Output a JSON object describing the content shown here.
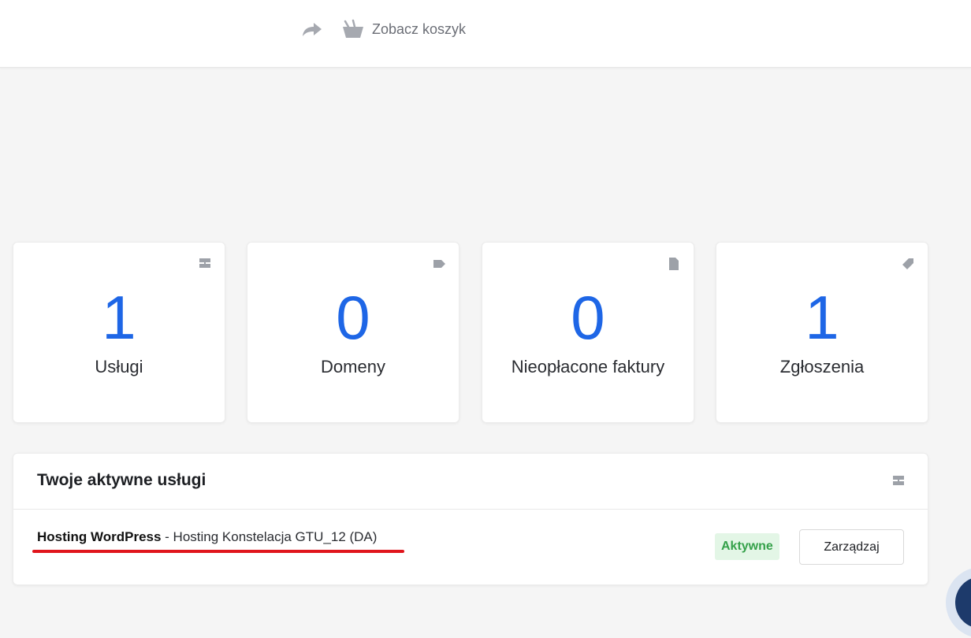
{
  "header": {
    "cart_label": "Zobacz koszyk",
    "icons": {
      "share": "share-arrow-icon",
      "cart": "basket-icon"
    }
  },
  "tiles": [
    {
      "count": "1",
      "title": "Usługi",
      "icon": "server-icon"
    },
    {
      "count": "0",
      "title": "Domeny",
      "icon": "tag-icon"
    },
    {
      "count": "0",
      "title": "Nieopłacone faktury",
      "icon": "document-icon"
    },
    {
      "count": "1",
      "title": "Zgłoszenia",
      "icon": "ticket-icon"
    }
  ],
  "active_services": {
    "title": "Twoje aktywne usługi",
    "icon": "server-icon",
    "items": [
      {
        "product": "Hosting WordPress",
        "detail": " - Hosting Konstelacja GTU_12 (DA)",
        "status": "Aktywne",
        "action": "Zarządzaj"
      }
    ]
  },
  "colors": {
    "accent": "#1e66e6",
    "status_active_text": "#35a14a",
    "status_active_bg": "#e3f6e6",
    "annotation_underline": "#e0151c",
    "background": "#f5f5f5"
  }
}
